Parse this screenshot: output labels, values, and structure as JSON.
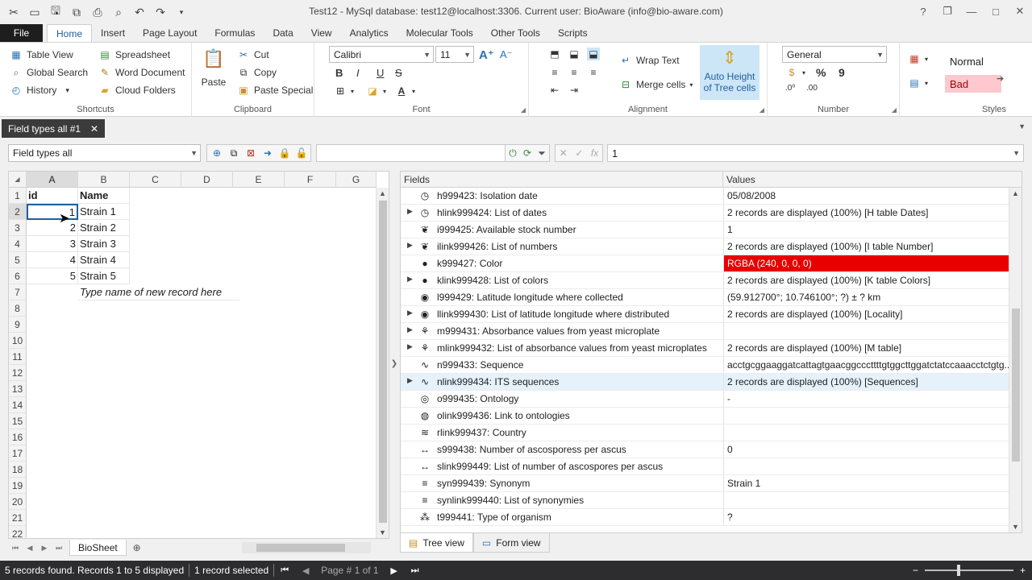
{
  "window": {
    "title": "Test12 - MySql database: test12@localhost:3306. Current user: BioAware (info@bio-aware.com)",
    "controls": [
      "?",
      "❐",
      "—",
      "□",
      "✕"
    ]
  },
  "ribbon_tabs": {
    "file": "File",
    "items": [
      "Home",
      "Insert",
      "Page Layout",
      "Formulas",
      "Data",
      "View",
      "Analytics",
      "Molecular Tools",
      "Other Tools",
      "Scripts"
    ]
  },
  "shortcuts": {
    "table_view": "Table View",
    "global_search": "Global Search",
    "history": "History",
    "spreadsheet": "Spreadsheet",
    "word_document": "Word Document",
    "cloud_folders": "Cloud Folders",
    "label": "Shortcuts"
  },
  "clipboard": {
    "paste": "Paste",
    "cut": "Cut",
    "copy": "Copy",
    "paste_special": "Paste Special",
    "label": "Clipboard"
  },
  "font": {
    "family": "Calibri",
    "size": "11",
    "bold": "B",
    "italic": "I",
    "underline": "U",
    "strike": "S",
    "label": "Font"
  },
  "alignment": {
    "wrap_text": "Wrap Text",
    "merge_cells": "Merge cells",
    "auto_height_1": "Auto Height",
    "auto_height_2": "of Tree cells",
    "label": "Alignment"
  },
  "number": {
    "format": "General",
    "percent": "%",
    "comma": "9",
    "label": "Number"
  },
  "styles": {
    "normal": "Normal",
    "bad": "Bad",
    "label": "Styles"
  },
  "doc_tab": {
    "title": "Field types all #1"
  },
  "toolbar": {
    "view_select": "Field types all",
    "formula_value": "1"
  },
  "sheet": {
    "columns": [
      "A",
      "B",
      "C",
      "D",
      "E",
      "F",
      "G"
    ],
    "rows": [
      "1",
      "2",
      "3",
      "4",
      "5",
      "6",
      "7",
      "8",
      "9",
      "10",
      "11",
      "12",
      "13",
      "14",
      "15",
      "16",
      "17",
      "18",
      "19",
      "20",
      "21",
      "22"
    ],
    "header": {
      "id": "id",
      "name": "Name"
    },
    "records": [
      {
        "id": "1",
        "name": "Strain 1"
      },
      {
        "id": "2",
        "name": "Strain 2"
      },
      {
        "id": "3",
        "name": "Strain 3"
      },
      {
        "id": "4",
        "name": "Strain 4"
      },
      {
        "id": "5",
        "name": "Strain 5"
      }
    ],
    "new_record_hint": "Type name of new record here",
    "tab_name": "BioSheet"
  },
  "fields_grid": {
    "col_fields": "Fields",
    "col_values": "Values",
    "rows": [
      {
        "icon": "clock-icon",
        "glyph": "◷",
        "expand": false,
        "name": "h999423: Isolation date",
        "value": "05/08/2008"
      },
      {
        "icon": "clock-icon",
        "glyph": "◷",
        "expand": true,
        "name": "hlink999424: List of dates",
        "value": "2 records are displayed (100%) [H table Dates]"
      },
      {
        "icon": "thermometer-icon",
        "glyph": "❦",
        "expand": false,
        "name": "i999425: Available stock number",
        "value": "1"
      },
      {
        "icon": "thermometer-icon",
        "glyph": "❦",
        "expand": true,
        "name": "ilink999426: List of numbers",
        "value": "2 records are displayed (100%) [I table Number]"
      },
      {
        "icon": "color-wheel-icon",
        "glyph": "●",
        "expand": false,
        "name": "k999427: Color",
        "value": "RGBA (240, 0, 0, 0)",
        "red": true
      },
      {
        "icon": "color-wheel-icon",
        "glyph": "●",
        "expand": true,
        "name": "klink999428: List of colors",
        "value": "2 records are displayed (100%) [K table Colors]"
      },
      {
        "icon": "globe-icon",
        "glyph": "◉",
        "expand": false,
        "name": "l999429: Latitude longitude where collected",
        "value": "(59.912700°; 10.746100°; ?) ± ? km"
      },
      {
        "icon": "globe-icon",
        "glyph": "◉",
        "expand": true,
        "name": "llink999430: List of latitude longitude where distributed",
        "value": "2 records are displayed (100%) [Locality]"
      },
      {
        "icon": "microplate-icon",
        "glyph": "⚘",
        "expand": true,
        "name": "m999431: Absorbance values from yeast microplate",
        "value": ""
      },
      {
        "icon": "microplate-icon",
        "glyph": "⚘",
        "expand": true,
        "name": "mlink999432: List of absorbance values from yeast microplates",
        "value": "2 records are displayed (100%) [M table]"
      },
      {
        "icon": "dna-icon",
        "glyph": "∿",
        "expand": false,
        "name": "n999433: Sequence",
        "value": "acctgcggaaggatcattagtgaacggcccttttgtggcttggatctatccaaacctctgtg..."
      },
      {
        "icon": "dna-icon",
        "glyph": "∿",
        "expand": true,
        "name": "nlink999434: ITS sequences",
        "value": "2 records are displayed (100%) [Sequences]",
        "selected": true
      },
      {
        "icon": "ontology-icon",
        "glyph": "◎",
        "expand": false,
        "name": "o999435: Ontology",
        "value": "-"
      },
      {
        "icon": "ontology-link-icon",
        "glyph": "◍",
        "expand": false,
        "name": "olink999436: Link to ontologies",
        "value": ""
      },
      {
        "icon": "country-icon",
        "glyph": "≋",
        "expand": false,
        "name": "rlink999437: Country",
        "value": ""
      },
      {
        "icon": "arrows-icon",
        "glyph": "↔",
        "expand": false,
        "name": "s999438: Number of ascosporess per ascus",
        "value": "0"
      },
      {
        "icon": "arrows-icon",
        "glyph": "↔",
        "expand": false,
        "name": "slink999449: List of number of ascospores per ascus",
        "value": ""
      },
      {
        "icon": "synonym-icon",
        "glyph": "≡",
        "expand": false,
        "name": "syn999439: Synonym",
        "value": "Strain 1"
      },
      {
        "icon": "synonym-list-icon",
        "glyph": "≡",
        "expand": false,
        "name": "synlink999440: List of synonymies",
        "value": ""
      },
      {
        "icon": "organism-icon",
        "glyph": "⁂",
        "expand": false,
        "name": "t999441: Type of organism",
        "value": "?"
      }
    ]
  },
  "view_tabs": {
    "tree_view": "Tree view",
    "form_view": "Form view"
  },
  "status": {
    "records_found": "5 records found. Records 1 to 5 displayed",
    "selected": "1 record selected",
    "page": "Page # 1 of 1"
  },
  "colors": {
    "accent": "#1e5fa0",
    "status_bg": "#2d2d30",
    "red_value": "#e80000",
    "bad_style": "#ffc7ce"
  }
}
